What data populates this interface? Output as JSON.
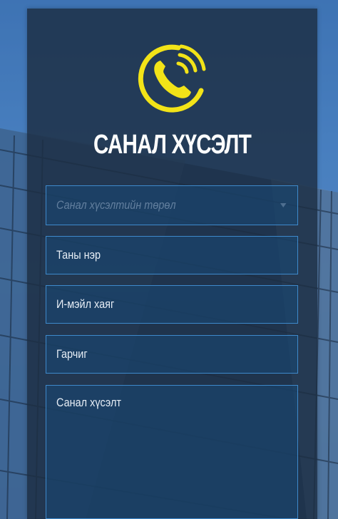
{
  "form": {
    "title": "САНАЛ ХҮСЭЛТ",
    "logo_icon": "phone-ringing-icon",
    "accent_color": "#f2e318",
    "select": {
      "placeholder": "Санал хүсэлтийн төрөл"
    },
    "fields": {
      "name_placeholder": "Таны нэр",
      "email_placeholder": "И-мэйл хаяг",
      "subject_placeholder": "Гарчиг",
      "message_placeholder": "Санал хүсэлт"
    }
  }
}
